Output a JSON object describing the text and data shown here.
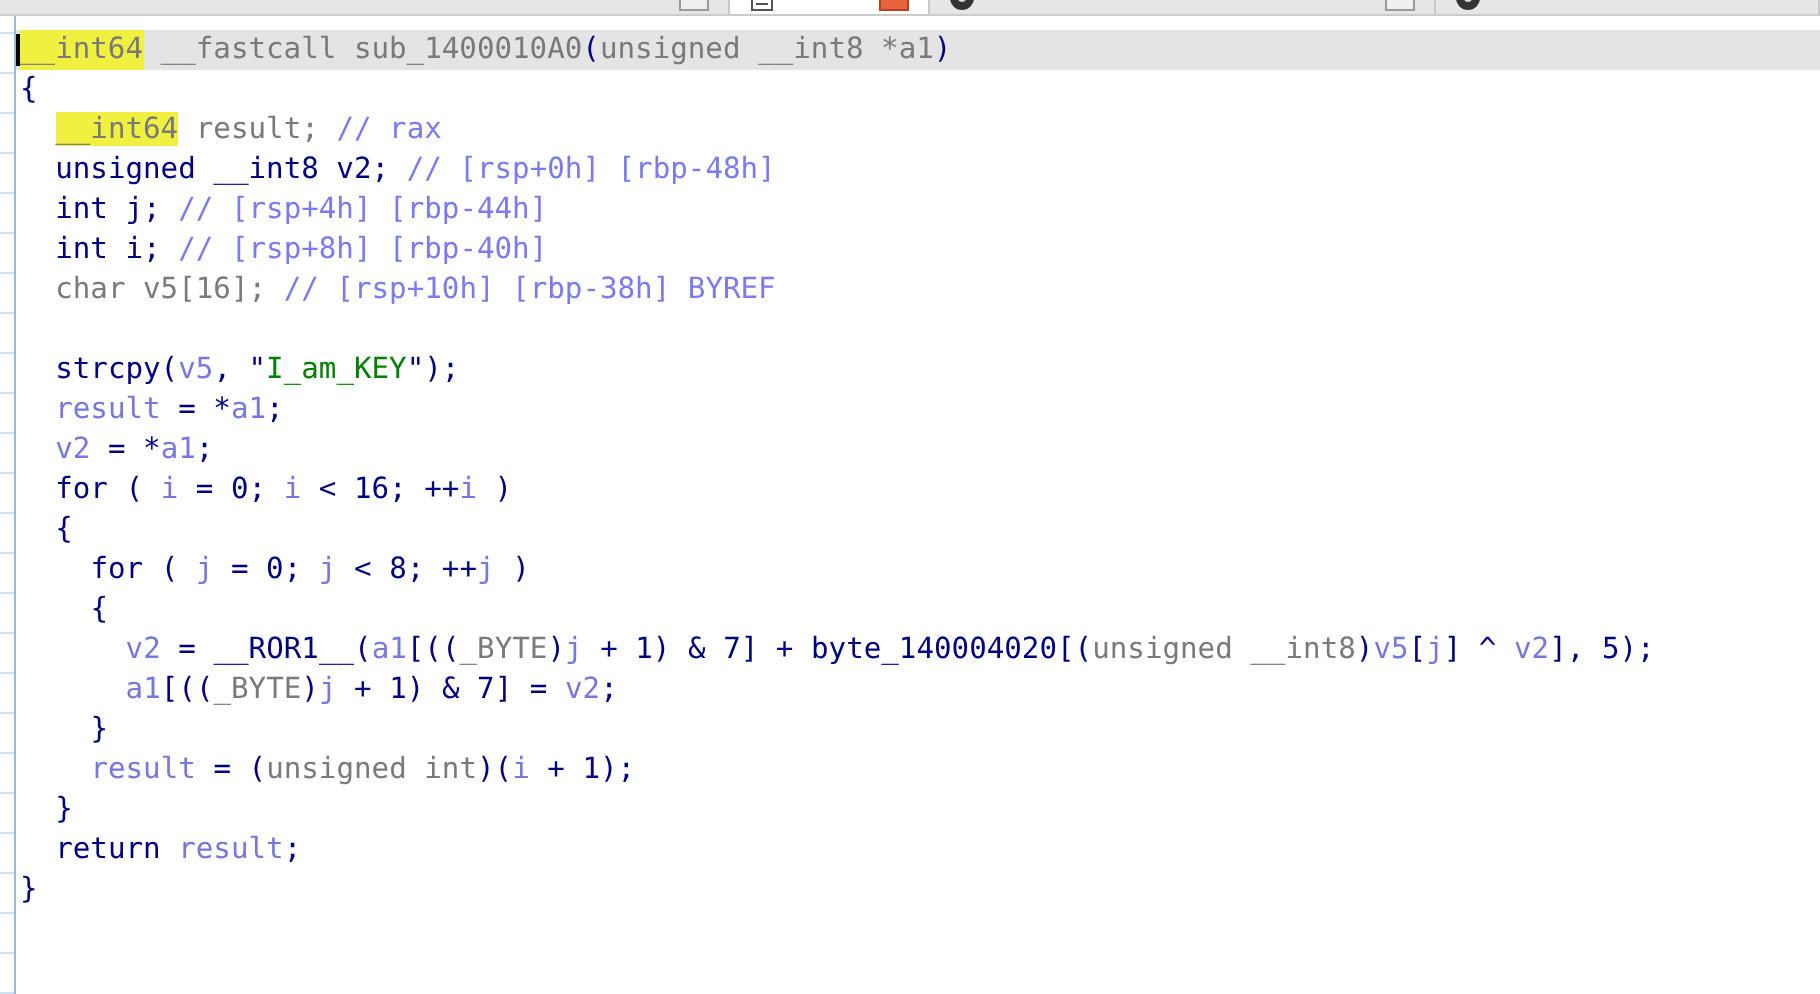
{
  "tabs": [
    {
      "selected": false
    },
    {
      "selected": true
    },
    {
      "selected": false
    },
    {
      "selected": false
    }
  ],
  "code": {
    "header": [
      {
        "kind": "hl",
        "text": "__int64"
      },
      {
        "kind": "gray",
        "text": " __fastcall sub_1400010A0"
      },
      {
        "kind": "text",
        "text": "("
      },
      {
        "kind": "gray",
        "text": "unsigned __int8 *a1"
      },
      {
        "kind": "text",
        "text": ")"
      }
    ],
    "lines": [
      {
        "tokens": [
          {
            "kind": "text",
            "text": "{"
          }
        ],
        "children": [
          {
            "tokens": [
              {
                "kind": "hl",
                "text": "__int64"
              },
              {
                "kind": "gray",
                "text": " result; "
              },
              {
                "kind": "comment",
                "text": "// rax"
              }
            ]
          },
          {
            "tokens": [
              {
                "kind": "text",
                "text": "unsigned __int8 v2; "
              },
              {
                "kind": "comment",
                "text": "// [rsp+0h] [rbp-48h]"
              }
            ]
          },
          {
            "tokens": [
              {
                "kind": "text",
                "text": "int j; "
              },
              {
                "kind": "comment",
                "text": "// [rsp+4h] [rbp-44h]"
              }
            ]
          },
          {
            "tokens": [
              {
                "kind": "text",
                "text": "int i; "
              },
              {
                "kind": "comment",
                "text": "// [rsp+8h] [rbp-40h]"
              }
            ]
          },
          {
            "tokens": [
              {
                "kind": "gray",
                "text": "char v5[16]; "
              },
              {
                "kind": "comment",
                "text": "// [rsp+10h] [rbp-38h] BYREF"
              }
            ]
          },
          {
            "blank_before": true,
            "tokens": [
              {
                "kind": "text",
                "text": "strcpy("
              },
              {
                "kind": "var",
                "text": "v5"
              },
              {
                "kind": "text",
                "text": ", \""
              },
              {
                "kind": "string",
                "text": "I_am_KEY"
              },
              {
                "kind": "text",
                "text": "\");"
              }
            ]
          },
          {
            "tokens": [
              {
                "kind": "var",
                "text": "result"
              },
              {
                "kind": "text",
                "text": " = *"
              },
              {
                "kind": "var",
                "text": "a1"
              },
              {
                "kind": "text",
                "text": ";"
              }
            ]
          },
          {
            "tokens": [
              {
                "kind": "var",
                "text": "v2"
              },
              {
                "kind": "text",
                "text": " = *"
              },
              {
                "kind": "var",
                "text": "a1"
              },
              {
                "kind": "text",
                "text": ";"
              }
            ]
          },
          {
            "tokens": [
              {
                "kind": "text",
                "text": "for ( "
              },
              {
                "kind": "var",
                "text": "i"
              },
              {
                "kind": "text",
                "text": " = 0; "
              },
              {
                "kind": "var",
                "text": "i"
              },
              {
                "kind": "text",
                "text": " < 16; ++"
              },
              {
                "kind": "var",
                "text": "i"
              },
              {
                "kind": "text",
                "text": " )"
              }
            ]
          },
          {
            "tokens": [
              {
                "kind": "text",
                "text": "{"
              }
            ],
            "children": [
              {
                "tokens": [
                  {
                    "kind": "text",
                    "text": "for ( "
                  },
                  {
                    "kind": "var",
                    "text": "j"
                  },
                  {
                    "kind": "text",
                    "text": " = 0; "
                  },
                  {
                    "kind": "var",
                    "text": "j"
                  },
                  {
                    "kind": "text",
                    "text": " < 8; ++"
                  },
                  {
                    "kind": "var",
                    "text": "j"
                  },
                  {
                    "kind": "text",
                    "text": " )"
                  }
                ]
              },
              {
                "tokens": [
                  {
                    "kind": "text",
                    "text": "{"
                  }
                ],
                "children": [
                  {
                    "tokens": [
                      {
                        "kind": "var",
                        "text": "v2"
                      },
                      {
                        "kind": "text",
                        "text": " = __ROR1__("
                      },
                      {
                        "kind": "var",
                        "text": "a1"
                      },
                      {
                        "kind": "text",
                        "text": "[(("
                      },
                      {
                        "kind": "gray",
                        "text": "_BYTE"
                      },
                      {
                        "kind": "text",
                        "text": ")"
                      },
                      {
                        "kind": "var",
                        "text": "j"
                      },
                      {
                        "kind": "text",
                        "text": " + 1) & 7] + byte_140004020[("
                      },
                      {
                        "kind": "gray",
                        "text": "unsigned __int8"
                      },
                      {
                        "kind": "text",
                        "text": ")"
                      },
                      {
                        "kind": "var",
                        "text": "v5"
                      },
                      {
                        "kind": "text",
                        "text": "["
                      },
                      {
                        "kind": "var",
                        "text": "j"
                      },
                      {
                        "kind": "text",
                        "text": "] ^ "
                      },
                      {
                        "kind": "var",
                        "text": "v2"
                      },
                      {
                        "kind": "text",
                        "text": "], 5);"
                      }
                    ]
                  },
                  {
                    "tokens": [
                      {
                        "kind": "var",
                        "text": "a1"
                      },
                      {
                        "kind": "text",
                        "text": "[(("
                      },
                      {
                        "kind": "gray",
                        "text": "_BYTE"
                      },
                      {
                        "kind": "text",
                        "text": ")"
                      },
                      {
                        "kind": "var",
                        "text": "j"
                      },
                      {
                        "kind": "text",
                        "text": " + 1) & 7] = "
                      },
                      {
                        "kind": "var",
                        "text": "v2"
                      },
                      {
                        "kind": "text",
                        "text": ";"
                      }
                    ]
                  }
                ]
              },
              {
                "tokens": [
                  {
                    "kind": "text",
                    "text": "}"
                  }
                ]
              },
              {
                "tokens": [
                  {
                    "kind": "var",
                    "text": "result"
                  },
                  {
                    "kind": "text",
                    "text": " = ("
                  },
                  {
                    "kind": "gray",
                    "text": "unsigned int"
                  },
                  {
                    "kind": "text",
                    "text": ")("
                  },
                  {
                    "kind": "var",
                    "text": "i"
                  },
                  {
                    "kind": "text",
                    "text": " + 1);"
                  }
                ]
              }
            ]
          },
          {
            "tokens": [
              {
                "kind": "text",
                "text": "}"
              }
            ]
          },
          {
            "tokens": [
              {
                "kind": "text",
                "text": "return "
              },
              {
                "kind": "var",
                "text": "result"
              },
              {
                "kind": "text",
                "text": ";"
              }
            ]
          }
        ]
      },
      {
        "tokens": [
          {
            "kind": "text",
            "text": "}"
          }
        ]
      }
    ]
  }
}
